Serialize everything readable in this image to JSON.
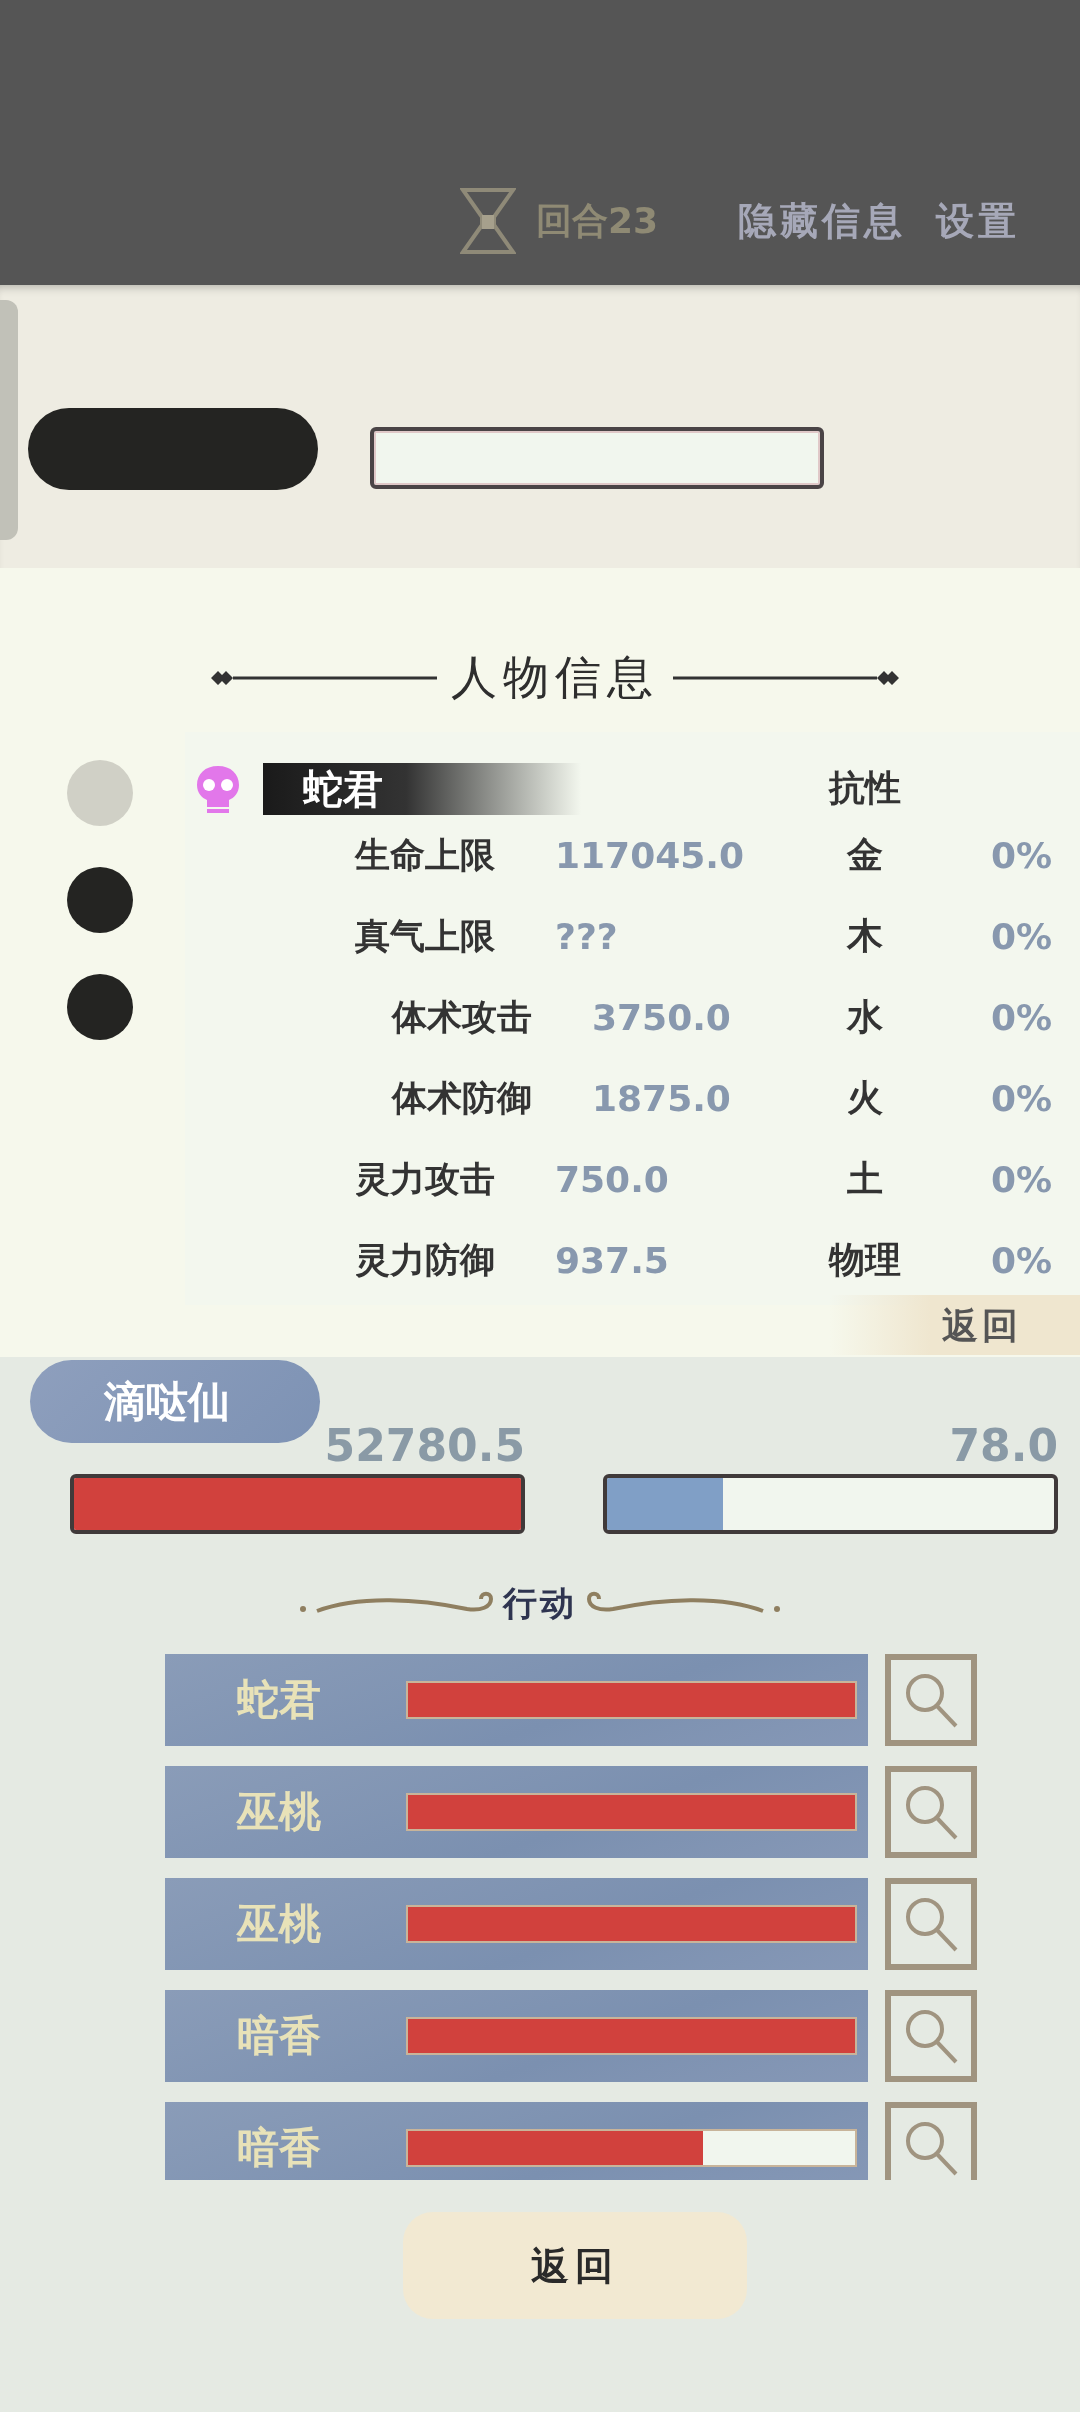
{
  "top_bar": {
    "round": "回合23",
    "hide_info": "隐藏信息",
    "settings": "设置"
  },
  "info_panel": {
    "title": "人物信息",
    "dots": [
      {
        "selected": true
      },
      {
        "selected": false
      },
      {
        "selected": false
      }
    ],
    "name": "蛇君",
    "resist_header": "抗性",
    "stats": [
      {
        "label": "生命上限",
        "value": "117045.0",
        "indented": false
      },
      {
        "label": "真气上限",
        "value": "???",
        "indented": false
      },
      {
        "label": "体术攻击",
        "value": "3750.0",
        "indented": true
      },
      {
        "label": "体术防御",
        "value": "1875.0",
        "indented": true
      },
      {
        "label": "灵力攻击",
        "value": "750.0",
        "indented": false
      },
      {
        "label": "灵力防御",
        "value": "937.5",
        "indented": false
      }
    ],
    "resistances": [
      {
        "element": "金",
        "value": "0%"
      },
      {
        "element": "木",
        "value": "0%"
      },
      {
        "element": "水",
        "value": "0%"
      },
      {
        "element": "火",
        "value": "0%"
      },
      {
        "element": "土",
        "value": "0%"
      },
      {
        "element": "物理",
        "value": "0%"
      }
    ],
    "back": "返回"
  },
  "player": {
    "name": "滴哒仙",
    "bars": [
      {
        "kind": "health",
        "reading": "52780.5",
        "level": 1
      },
      {
        "kind": "energy",
        "reading": "78.0",
        "level": 0.26
      }
    ]
  },
  "actions": {
    "title": "行动",
    "items": [
      {
        "name": "蛇君",
        "level": 1
      },
      {
        "name": "巫桃",
        "level": 1
      },
      {
        "name": "巫桃",
        "level": 1
      },
      {
        "name": "暗香",
        "level": 1
      },
      {
        "name": "暗香",
        "level": 0.66
      }
    ]
  },
  "back_button": "返回"
}
